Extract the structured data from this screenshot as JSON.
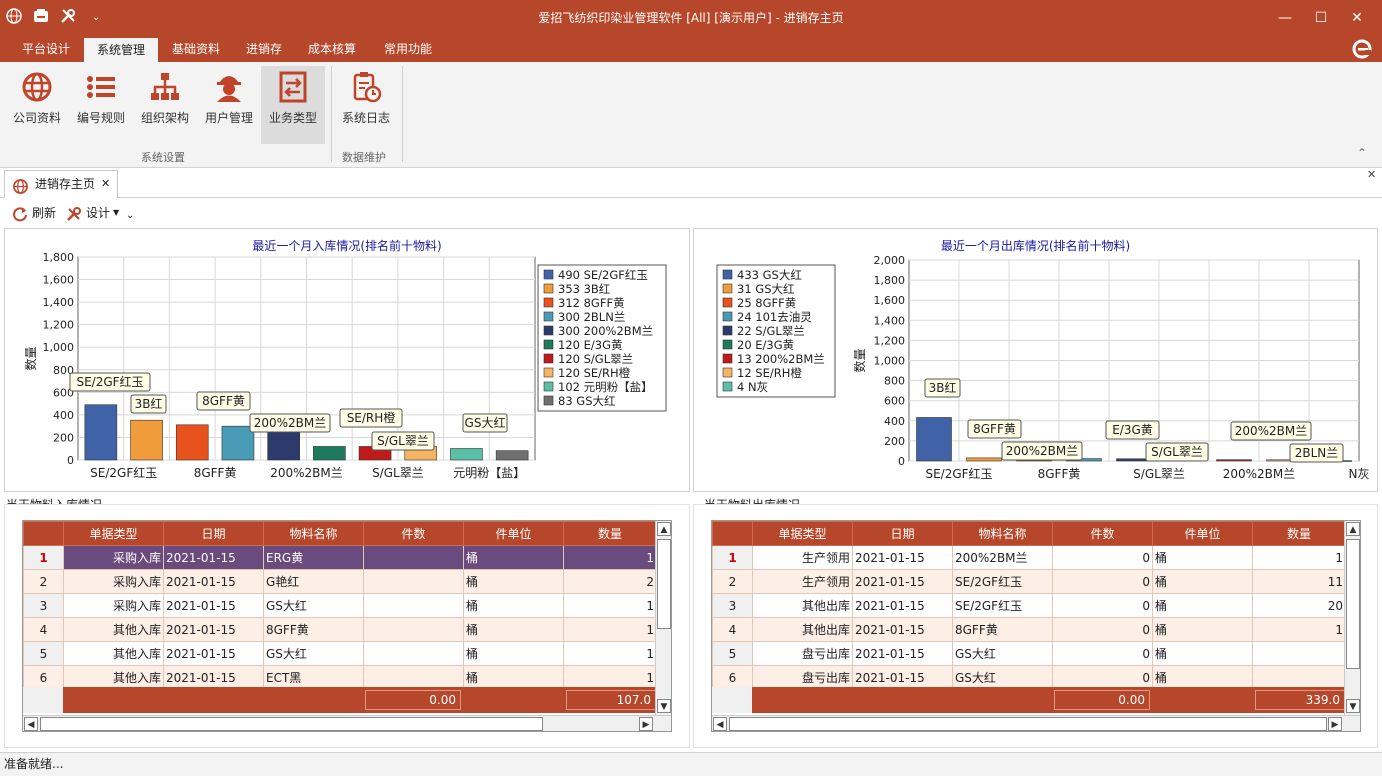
{
  "title_bar": {
    "title": "爱招飞纺织印染业管理软件 [All] [演示用户] - 进销存主页",
    "minimize": "—",
    "maximize": "☐",
    "close": "✕"
  },
  "ribbon": {
    "tabs": [
      "平台设计",
      "系统管理",
      "基础资料",
      "进销存",
      "成本核算",
      "常用功能"
    ],
    "active_tab": "系统管理",
    "buttons": [
      "公司资料",
      "编号规则",
      "组织架构",
      "用户管理",
      "业务类型",
      "系统日志"
    ],
    "groups": [
      "系统设置",
      "数据维护"
    ],
    "collapse": "⌃"
  },
  "doc_tab": {
    "label": "进销存主页",
    "close": "✕"
  },
  "toolbar": {
    "refresh": "刷新",
    "design": "设计"
  },
  "chart_in": {
    "ylabel": "数量",
    "ylabel_visual": "数\n量"
  },
  "chart_out": {
    "ylabel": "数量"
  },
  "chart_data": [
    {
      "type": "bar",
      "title": "最近一个月入库情况(排名前十物料)",
      "ylabel": "数量",
      "ylim": [
        0,
        1800
      ],
      "yticks": [
        "0",
        "200",
        "400",
        "600",
        "800",
        "1,000",
        "1,200",
        "1,400",
        "1,600",
        "1,800"
      ],
      "categories": [
        "SE/2GF红玉",
        "3B红",
        "8GFF黄",
        "2BLN兰",
        "200%2BM兰",
        "E/3G黄",
        "S/GL翠兰",
        "SE/RH橙",
        "元明粉【盐】",
        "GS大红"
      ],
      "values": [
        490,
        353,
        312,
        300,
        300,
        120,
        120,
        120,
        102,
        83
      ],
      "x_tick_labels": [
        "SE/2GF红玉",
        "8GFF黄",
        "200%2BM兰",
        "S/GL翠兰",
        "元明粉【盐】"
      ],
      "callouts": [
        "SE/2GF红玉",
        "3B红",
        "8GFF黄",
        "200%2BM兰",
        "SE/RH橙",
        "S/GL翠兰",
        "GS大红"
      ],
      "colors": [
        "#4063a8",
        "#f09c3a",
        "#e8521c",
        "#4a9bb5",
        "#2c3b6b",
        "#1d7a5c",
        "#c01a1a",
        "#f6b463",
        "#5bbfa6",
        "#6f6f6f"
      ],
      "legend": [
        "490 SE/2GF红玉",
        "353 3B红",
        "312 8GFF黄",
        "300 2BLN兰",
        "300 200%2BM兰",
        "120 E/3G黄",
        "120 S/GL翠兰",
        "120 SE/RH橙",
        "102 元明粉【盐】",
        "83 GS大红"
      ],
      "legend_position": "right",
      "grid": true
    },
    {
      "type": "bar",
      "title": "最近一个月出库情况(排名前十物料)",
      "ylabel": "数量",
      "ylim": [
        0,
        2000
      ],
      "yticks": [
        "0",
        "200",
        "400",
        "600",
        "800",
        "1,000",
        "1,200",
        "1,400",
        "1,600",
        "1,800",
        "2,000"
      ],
      "categories": [
        "3B红",
        "GS大红",
        "8GFF黄",
        "101去油灵",
        "S/GL翠兰",
        "E/3G黄",
        "200%2BM兰",
        "SE/RH橙",
        "N灰"
      ],
      "values": [
        433,
        31,
        25,
        24,
        22,
        20,
        13,
        12,
        4
      ],
      "x_tick_labels": [
        "SE/2GF红玉",
        "8GFF黄",
        "S/GL翠兰",
        "200%2BM兰",
        "N灰"
      ],
      "callouts": [
        "3B红",
        "8GFF黄",
        "200%2BM兰",
        "E/3G黄",
        "S/GL翠兰",
        "200%2BM兰",
        "2BLN兰"
      ],
      "colors": [
        "#4063a8",
        "#f09c3a",
        "#e8521c",
        "#4a9bb5",
        "#2c3b6b",
        "#1d7a5c",
        "#c01a1a",
        "#f6b463",
        "#5bbfa6"
      ],
      "legend": [
        "433 GS大红",
        "31 GS大红",
        "25 8GFF黄",
        "24 101去油灵",
        "22 S/GL翠兰",
        "20 E/3G黄",
        "13 200%2BM兰",
        "12 SE/RH橙",
        "4 N灰"
      ],
      "legend_position": "left",
      "grid": true
    }
  ],
  "grid_in": {
    "title": "当天物料入库情况",
    "columns": [
      "单据类型",
      "日期",
      "物料名称",
      "件数",
      "件单位",
      "数量"
    ],
    "rows": [
      {
        "num": "1",
        "type": "采购入库",
        "date": "2021-01-15",
        "material": "ERG黄",
        "pieces": "",
        "unit": "桶",
        "qty": "1"
      },
      {
        "num": "2",
        "type": "采购入库",
        "date": "2021-01-15",
        "material": "G艳红",
        "pieces": "",
        "unit": "桶",
        "qty": "2"
      },
      {
        "num": "3",
        "type": "采购入库",
        "date": "2021-01-15",
        "material": "GS大红",
        "pieces": "",
        "unit": "桶",
        "qty": "1"
      },
      {
        "num": "4",
        "type": "其他入库",
        "date": "2021-01-15",
        "material": "8GFF黄",
        "pieces": "",
        "unit": "桶",
        "qty": "1"
      },
      {
        "num": "5",
        "type": "其他入库",
        "date": "2021-01-15",
        "material": "GS大红",
        "pieces": "",
        "unit": "桶",
        "qty": "1"
      },
      {
        "num": "6",
        "type": "其他入库",
        "date": "2021-01-15",
        "material": "ECT黑",
        "pieces": "",
        "unit": "桶",
        "qty": "1"
      }
    ],
    "total_pieces": "0.00",
    "total_qty": "107.0"
  },
  "grid_out": {
    "title": "当天物料出库情况",
    "columns": [
      "单据类型",
      "日期",
      "物料名称",
      "件数",
      "件单位",
      "数量"
    ],
    "rows": [
      {
        "num": "1",
        "type": "生产领用",
        "date": "2021-01-15",
        "material": "200%2BM兰",
        "pieces": "0",
        "unit": "桶",
        "qty": "1"
      },
      {
        "num": "2",
        "type": "生产领用",
        "date": "2021-01-15",
        "material": "SE/2GF红玉",
        "pieces": "0",
        "unit": "桶",
        "qty": "11"
      },
      {
        "num": "3",
        "type": "其他出库",
        "date": "2021-01-15",
        "material": "SE/2GF红玉",
        "pieces": "0",
        "unit": "桶",
        "qty": "20"
      },
      {
        "num": "4",
        "type": "其他出库",
        "date": "2021-01-15",
        "material": "8GFF黄",
        "pieces": "0",
        "unit": "桶",
        "qty": "1"
      },
      {
        "num": "5",
        "type": "盘亏出库",
        "date": "2021-01-15",
        "material": "GS大红",
        "pieces": "0",
        "unit": "桶",
        "qty": ""
      },
      {
        "num": "6",
        "type": "盘亏出库",
        "date": "2021-01-15",
        "material": "GS大红",
        "pieces": "0",
        "unit": "桶",
        "qty": ""
      }
    ],
    "total_pieces": "0.00",
    "total_qty": "339.0"
  },
  "status": {
    "text": "准备就绪..."
  },
  "icons": {
    "save": "save-icon",
    "tools": "tools-icon",
    "refresh": "refresh-icon",
    "design": "wrench-icon",
    "brand": "e-logo-icon",
    "globe": "globe-icon"
  },
  "colors": {
    "brand": "#b7472a",
    "selected_row": "#6b4a7e",
    "alt_row": "#fdeee6",
    "chart_title": "#1a1aa6"
  }
}
